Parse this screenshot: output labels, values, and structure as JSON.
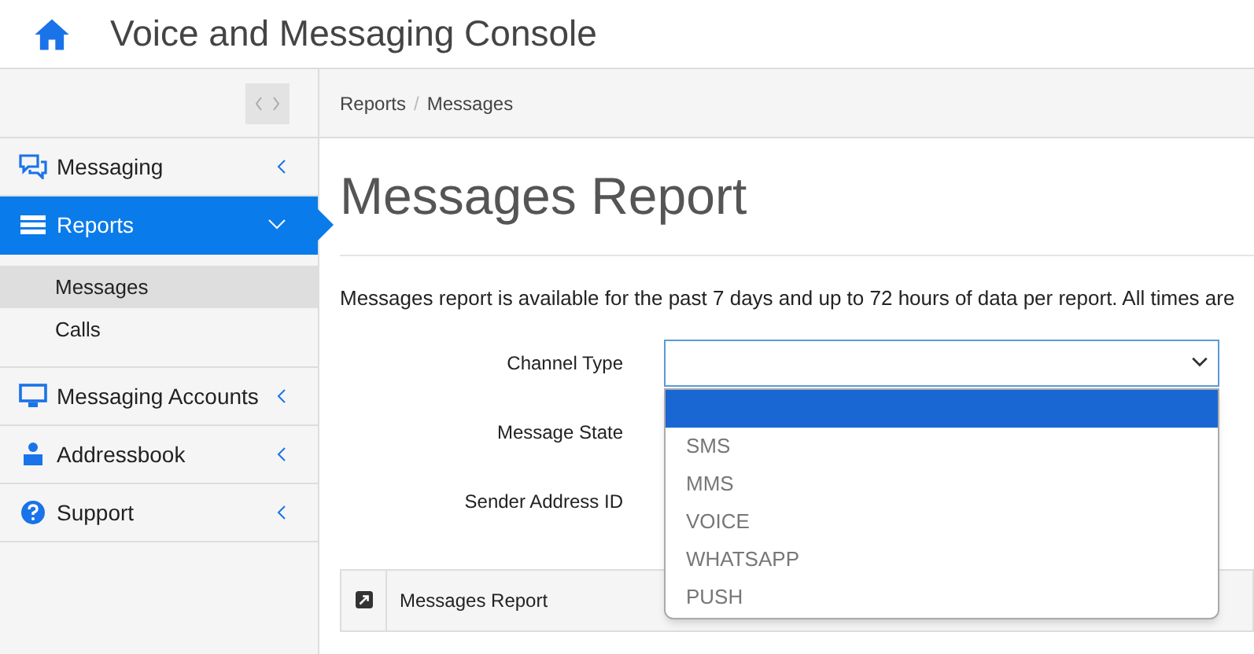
{
  "header": {
    "title": "Voice and Messaging Console"
  },
  "sidebar": {
    "items": [
      {
        "label": "Messaging",
        "selected": false,
        "expanded": false
      },
      {
        "label": "Reports",
        "selected": true,
        "expanded": true,
        "children": [
          {
            "label": "Messages",
            "selected": true
          },
          {
            "label": "Calls",
            "selected": false
          }
        ]
      },
      {
        "label": "Messaging Accounts",
        "selected": false,
        "expanded": false
      },
      {
        "label": "Addressbook",
        "selected": false,
        "expanded": false
      },
      {
        "label": "Support",
        "selected": false,
        "expanded": false
      }
    ]
  },
  "breadcrumb": {
    "items": [
      "Reports",
      "Messages"
    ],
    "separator": "/"
  },
  "page_title": "Messages Report",
  "description": "Messages report is available for the past 7 days and up to 72 hours of data per report. All times are",
  "form": {
    "fields": [
      {
        "label": "Channel Type",
        "expanded": true
      },
      {
        "label": "Message State"
      },
      {
        "label": "Sender Address ID"
      }
    ]
  },
  "channel_options": [
    {
      "selected": true
    },
    {
      "label": "SMS",
      "selected": false
    },
    {
      "label": "MMS",
      "selected": false
    },
    {
      "label": "VOICE",
      "selected": false
    },
    {
      "label": "WHATSAPP",
      "selected": false
    },
    {
      "label": "PUSH",
      "selected": false
    }
  ],
  "panel": {
    "title": "Messages Report"
  }
}
